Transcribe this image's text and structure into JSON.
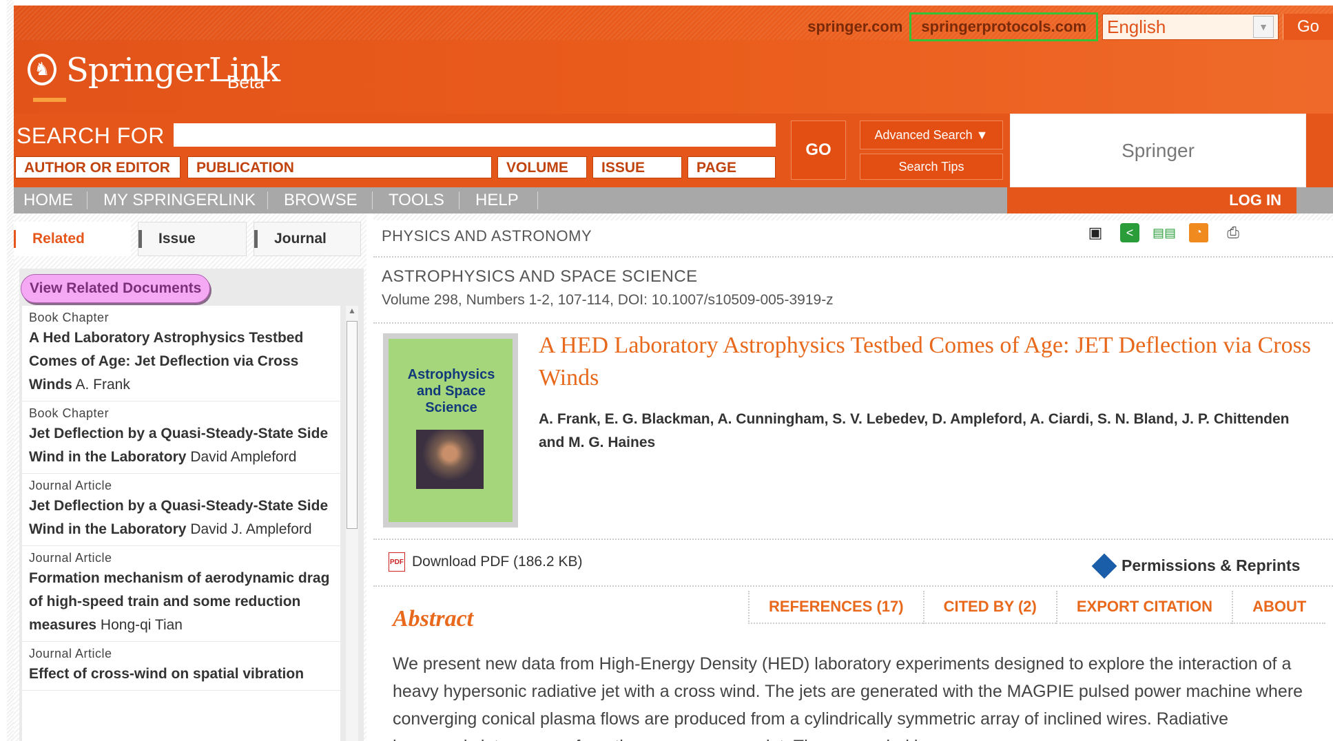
{
  "header": {
    "links": [
      "springer.com",
      "springerprotocols.com"
    ],
    "language": "English",
    "go": "Go",
    "brand": "SpringerLink",
    "beta": "Beta"
  },
  "search": {
    "label": "SEARCH FOR",
    "fields": [
      "AUTHOR OR EDITOR",
      "PUBLICATION",
      "VOLUME",
      "ISSUE",
      "PAGE"
    ],
    "go": "GO",
    "advanced": "Advanced Search ▼",
    "tips": "Search Tips",
    "springer": "Springer"
  },
  "nav": {
    "items": [
      "HOME",
      "MY SPRINGERLINK",
      "BROWSE",
      "TOOLS",
      "HELP"
    ],
    "login": "LOG IN"
  },
  "sidebar": {
    "tabs": [
      "Related",
      "Issue",
      "Journal"
    ],
    "view_related": "View Related Documents",
    "items": [
      {
        "type": "Book Chapter",
        "title": "A Hed Laboratory Astrophysics Testbed Comes of Age: Jet Deflection via Cross Winds",
        "author": "A. Frank"
      },
      {
        "type": "Book Chapter",
        "title": "Jet Deflection by a Quasi-Steady-State Side Wind in the Laboratory",
        "author": "David Ampleford"
      },
      {
        "type": "Journal Article",
        "title": "Jet Deflection by a Quasi-Steady-State Side Wind in the Laboratory",
        "author": "David J. Ampleford"
      },
      {
        "type": "Journal Article",
        "title": "Formation mechanism of aerodynamic drag of high-speed train and some reduction measures",
        "author": "Hong-qi Tian"
      },
      {
        "type": "Journal Article",
        "title": "Effect of cross-wind on spatial vibration",
        "author": ""
      }
    ]
  },
  "main": {
    "category": "PHYSICS AND ASTRONOMY",
    "journal": "ASTROPHYSICS AND SPACE SCIENCE",
    "volume": "Volume 298, Numbers 1-2, 107-114, DOI: 10.1007/s10509-005-3919-z",
    "cover_text": "Astrophysics and Space Science",
    "title": "A HED Laboratory Astrophysics Testbed Comes of Age: JET Deflection via Cross Winds",
    "authors": "A. Frank, E. G. Blackman, A. Cunningham, S. V. Lebedev, D. Ampleford, A. Ciardi, S. N. Bland, J. P. Chittenden and M. G. Haines",
    "download": "Download PDF (186.2 KB)",
    "permissions": "Permissions & Reprints",
    "tabs": [
      "REFERENCES (17)",
      "CITED BY (2)",
      "EXPORT CITATION",
      "ABOUT"
    ],
    "abstract_heading": "Abstract",
    "abstract": "We present new data from High-Energy Density (HED) laboratory experiments designed to explore the interaction of a heavy hypersonic radiative jet with a cross wind. The jets are generated with the MAGPIE pulsed power machine where converging conical plasma flows are produced from a cylindrically symmetric array of inclined wires. Radiative hypersonic jets emerge from the convergence point. The cross wind is"
  }
}
